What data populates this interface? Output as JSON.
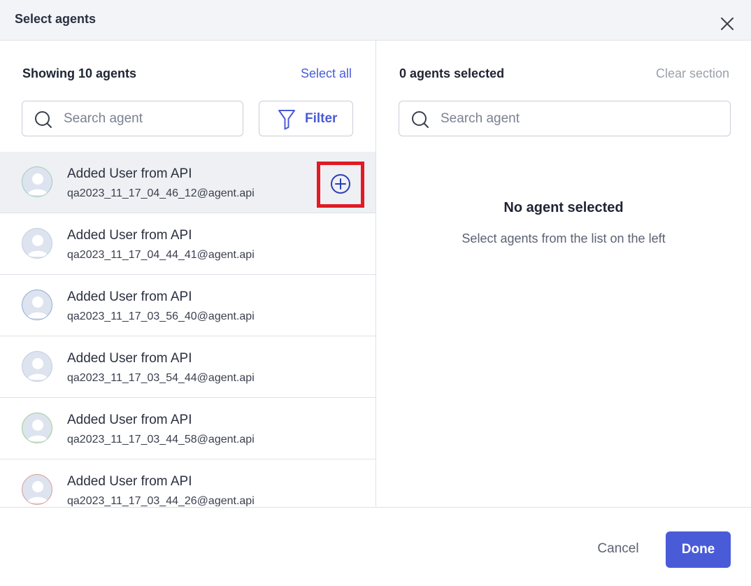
{
  "dialog": {
    "title": "Select agents"
  },
  "left": {
    "count_label": "Showing 10 agents",
    "select_all_label": "Select all",
    "search_placeholder": "Search agent",
    "filter_label": "Filter",
    "agents": [
      {
        "name": "Added User from API",
        "email": "qa2023_11_17_04_46_12@agent.api",
        "avatar_ring": "#9fcbc3"
      },
      {
        "name": "Added User from API",
        "email": "qa2023_11_17_04_44_41@agent.api",
        "avatar_ring": "#c3cce0"
      },
      {
        "name": "Added User from API",
        "email": "qa2023_11_17_03_56_40@agent.api",
        "avatar_ring": "#8fa9d6"
      },
      {
        "name": "Added User from API",
        "email": "qa2023_11_17_03_54_44@agent.api",
        "avatar_ring": "#c3cce0"
      },
      {
        "name": "Added User from API",
        "email": "qa2023_11_17_03_44_58@agent.api",
        "avatar_ring": "#9ccf8e"
      },
      {
        "name": "Added User from API",
        "email": "qa2023_11_17_03_44_26@agent.api",
        "avatar_ring": "#d99a9a"
      }
    ]
  },
  "right": {
    "count_label": "0 agents selected",
    "clear_label": "Clear section",
    "search_placeholder": "Search agent",
    "empty_title": "No agent selected",
    "empty_subtitle": "Select agents from the list on the left"
  },
  "footer": {
    "cancel_label": "Cancel",
    "done_label": "Done"
  },
  "icons": {
    "close": "close-icon",
    "search": "search-icon",
    "filter": "funnel-icon",
    "add": "plus-circle-icon",
    "avatar": "user-avatar-icon"
  },
  "colors": {
    "accent": "#4a5bd8",
    "highlight_frame": "#e01b24",
    "hover_row": "#eef0f3"
  }
}
